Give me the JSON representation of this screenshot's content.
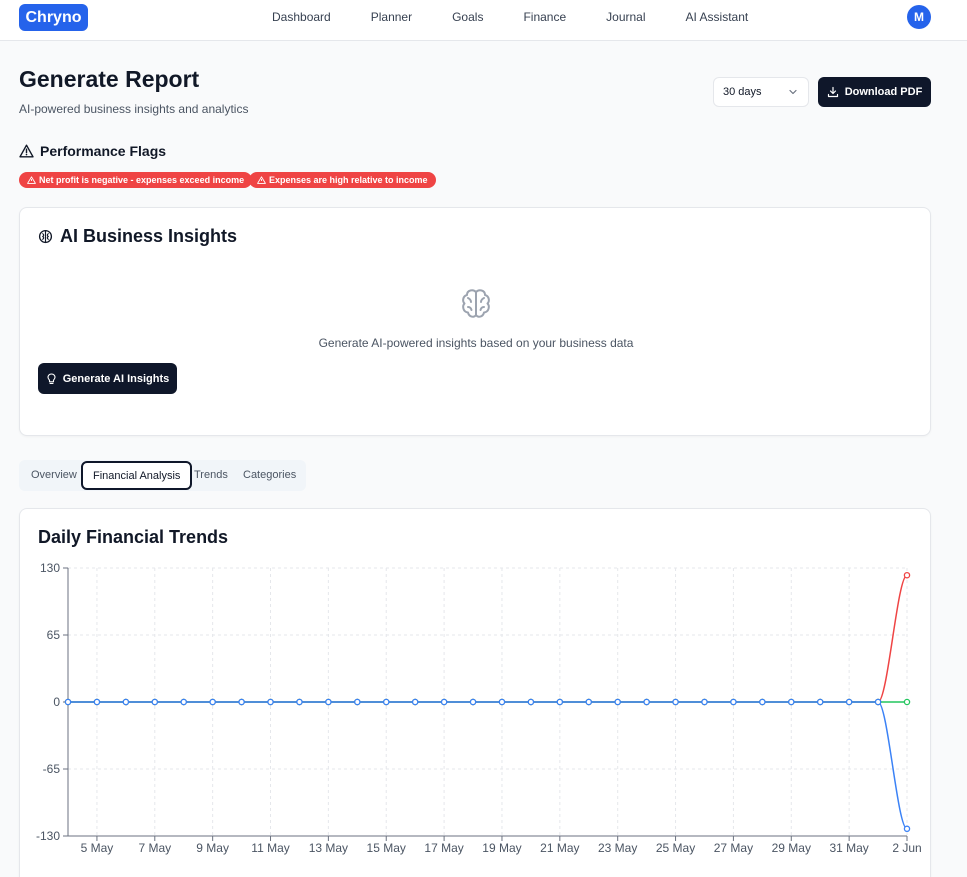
{
  "app": {
    "logo": "Chryno",
    "avatar_initial": "M",
    "accent": "#2563eb"
  },
  "nav": {
    "items": [
      {
        "label": "Dashboard"
      },
      {
        "label": "Planner"
      },
      {
        "label": "Goals"
      },
      {
        "label": "Finance"
      },
      {
        "label": "Journal"
      },
      {
        "label": "AI Assistant"
      }
    ]
  },
  "header": {
    "title": "Generate Report",
    "subtitle": "AI-powered business insights and analytics",
    "period_value": "30 days",
    "download_label": "Download PDF"
  },
  "flags": {
    "title": "Performance Flags",
    "items": [
      {
        "label": "Net profit is negative - expenses exceed income"
      },
      {
        "label": "Expenses are high relative to income"
      }
    ],
    "color": "#ef4444"
  },
  "insights": {
    "title": "AI Business Insights",
    "description": "Generate AI-powered insights based on your business data",
    "button_label": "Generate AI Insights"
  },
  "tabs": {
    "items": [
      {
        "label": "Overview"
      },
      {
        "label": "Financial Analysis",
        "active": true
      },
      {
        "label": "Trends"
      },
      {
        "label": "Categories"
      }
    ]
  },
  "chart": {
    "title": "Daily Financial Trends"
  },
  "chart_data": {
    "type": "line",
    "title": "Daily Financial Trends",
    "x": [
      "4 May",
      "5 May",
      "6 May",
      "7 May",
      "8 May",
      "9 May",
      "10 May",
      "11 May",
      "12 May",
      "13 May",
      "14 May",
      "15 May",
      "16 May",
      "17 May",
      "18 May",
      "19 May",
      "20 May",
      "21 May",
      "22 May",
      "23 May",
      "24 May",
      "25 May",
      "26 May",
      "27 May",
      "28 May",
      "29 May",
      "30 May",
      "31 May",
      "1 Jun",
      "2 Jun"
    ],
    "x_tick_labels": [
      "5 May",
      "7 May",
      "9 May",
      "11 May",
      "13 May",
      "15 May",
      "17 May",
      "19 May",
      "21 May",
      "23 May",
      "25 May",
      "27 May",
      "29 May",
      "31 May",
      "2 Jun"
    ],
    "y_ticks": [
      130,
      65,
      0,
      -65,
      -130
    ],
    "ylim": [
      -130,
      130
    ],
    "grid": true,
    "series": [
      {
        "color": "#ef4444",
        "values": [
          0,
          0,
          0,
          0,
          0,
          0,
          0,
          0,
          0,
          0,
          0,
          0,
          0,
          0,
          0,
          0,
          0,
          0,
          0,
          0,
          0,
          0,
          0,
          0,
          0,
          0,
          0,
          0,
          0,
          123
        ]
      },
      {
        "color": "#22c55e",
        "values": [
          0,
          0,
          0,
          0,
          0,
          0,
          0,
          0,
          0,
          0,
          0,
          0,
          0,
          0,
          0,
          0,
          0,
          0,
          0,
          0,
          0,
          0,
          0,
          0,
          0,
          0,
          0,
          0,
          0,
          0
        ]
      },
      {
        "color": "#3b82f6",
        "values": [
          0,
          0,
          0,
          0,
          0,
          0,
          0,
          0,
          0,
          0,
          0,
          0,
          0,
          0,
          0,
          0,
          0,
          0,
          0,
          0,
          0,
          0,
          0,
          0,
          0,
          0,
          0,
          0,
          0,
          -123
        ]
      }
    ]
  }
}
